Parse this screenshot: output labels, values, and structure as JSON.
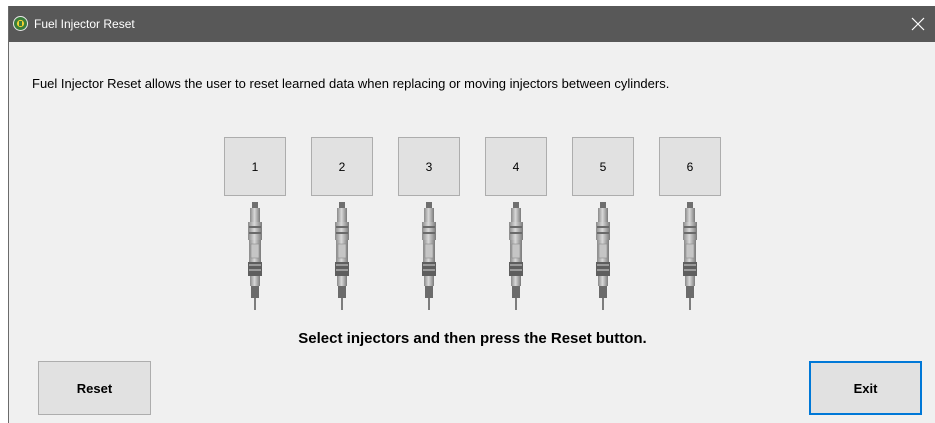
{
  "window": {
    "title": "Fuel Injector Reset",
    "icon": "circle-icon",
    "close_icon": "close-icon"
  },
  "main": {
    "description": "Fuel Injector Reset allows the user to reset learned data when replacing or moving injectors between cylinders.",
    "injectors": [
      {
        "label": "1"
      },
      {
        "label": "2"
      },
      {
        "label": "3"
      },
      {
        "label": "4"
      },
      {
        "label": "5"
      },
      {
        "label": "6"
      }
    ],
    "instruction": "Select injectors and then press the Reset button."
  },
  "actions": {
    "reset_label": "Reset",
    "exit_label": "Exit"
  },
  "colors": {
    "titlebar_bg": "#585858",
    "window_bg": "#f0f0f0",
    "button_bg": "#e1e1e1",
    "button_border": "#adadad",
    "focus_border": "#0078d7"
  }
}
